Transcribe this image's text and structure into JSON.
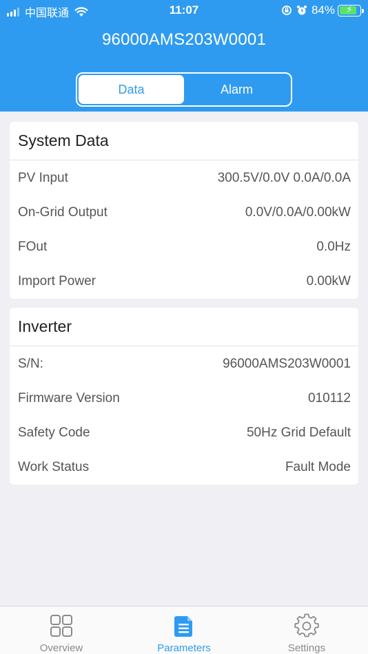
{
  "status_bar": {
    "carrier": "中国联通",
    "time": "11:07",
    "battery": "84%",
    "battery_level": 0.84
  },
  "header": {
    "title": "96000AMS203W0001"
  },
  "segments": [
    {
      "label": "Data",
      "active": true
    },
    {
      "label": "Alarm",
      "active": false
    }
  ],
  "system_data": {
    "title": "System Data",
    "rows": [
      {
        "label": "PV Input",
        "value": "300.5V/0.0V 0.0A/0.0A"
      },
      {
        "label": "On-Grid Output",
        "value": "0.0V/0.0A/0.00kW"
      },
      {
        "label": "FOut",
        "value": "0.0Hz"
      },
      {
        "label": "Import Power",
        "value": "0.00kW"
      }
    ]
  },
  "inverter": {
    "title": "Inverter",
    "rows": [
      {
        "label": "S/N:",
        "value": "96000AMS203W0001"
      },
      {
        "label": "Firmware Version",
        "value": "010112"
      },
      {
        "label": "Safety Code",
        "value": "50Hz Grid Default"
      },
      {
        "label": "Work Status",
        "value": "Fault Mode"
      }
    ]
  },
  "tabbar": [
    {
      "label": "Overview",
      "icon": "grid-icon",
      "active": false
    },
    {
      "label": "Parameters",
      "icon": "document-icon",
      "active": true
    },
    {
      "label": "Settings",
      "icon": "gear-icon",
      "active": false
    }
  ],
  "colors": {
    "accent": "#2f9bf0",
    "background": "#efeff4",
    "battery": "#5be36b"
  }
}
